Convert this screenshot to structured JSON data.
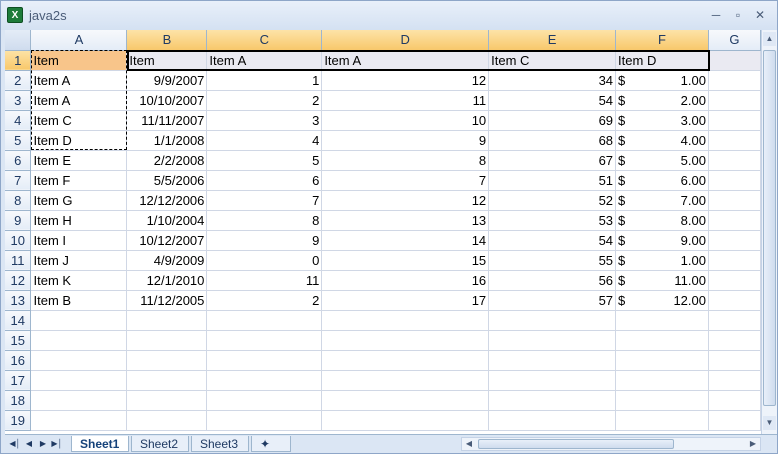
{
  "window": {
    "title": "java2s",
    "app_icon": "X"
  },
  "columns": [
    "A",
    "B",
    "C",
    "D",
    "E",
    "F",
    "G"
  ],
  "rows": [
    [
      "Item",
      "Item",
      "Item A",
      "Item A",
      "Item C",
      "Item D",
      ""
    ],
    [
      "Item A",
      "9/9/2007",
      "1",
      "12",
      "34",
      "1.00",
      ""
    ],
    [
      "Item A",
      "10/10/2007",
      "2",
      "11",
      "54",
      "2.00",
      ""
    ],
    [
      "Item C",
      "11/11/2007",
      "3",
      "10",
      "69",
      "3.00",
      ""
    ],
    [
      "Item D",
      "1/1/2008",
      "4",
      "9",
      "68",
      "4.00",
      ""
    ],
    [
      "Item E",
      "2/2/2008",
      "5",
      "8",
      "67",
      "5.00",
      ""
    ],
    [
      "Item F",
      "5/5/2006",
      "6",
      "7",
      "51",
      "6.00",
      ""
    ],
    [
      "Item G",
      "12/12/2006",
      "7",
      "12",
      "52",
      "7.00",
      ""
    ],
    [
      "Item H",
      "1/10/2004",
      "8",
      "13",
      "53",
      "8.00",
      ""
    ],
    [
      "Item I",
      "10/12/2007",
      "9",
      "14",
      "54",
      "9.00",
      ""
    ],
    [
      "Item J",
      "4/9/2009",
      "0",
      "15",
      "55",
      "1.00",
      ""
    ],
    [
      "Item K",
      "12/1/2010",
      "11",
      "16",
      "56",
      "11.00",
      ""
    ],
    [
      "Item B",
      "11/12/2005",
      "2",
      "17",
      "57",
      "12.00",
      ""
    ],
    [
      "",
      "",
      "",
      "",
      "",
      "",
      ""
    ],
    [
      "",
      "",
      "",
      "",
      "",
      "",
      ""
    ],
    [
      "",
      "",
      "",
      "",
      "",
      "",
      ""
    ],
    [
      "",
      "",
      "",
      "",
      "",
      "",
      ""
    ],
    [
      "",
      "",
      "",
      "",
      "",
      "",
      ""
    ],
    [
      "",
      "",
      "",
      "",
      "",
      "",
      ""
    ]
  ],
  "currency_symbol": "$",
  "sheet_tabs": [
    "Sheet1",
    "Sheet2",
    "Sheet3"
  ],
  "active_tab": "Sheet1",
  "colors": {
    "selected_header": "#f8c58a",
    "header_row_fill": "#eaeaf2",
    "gridline": "#d0d7e5"
  }
}
